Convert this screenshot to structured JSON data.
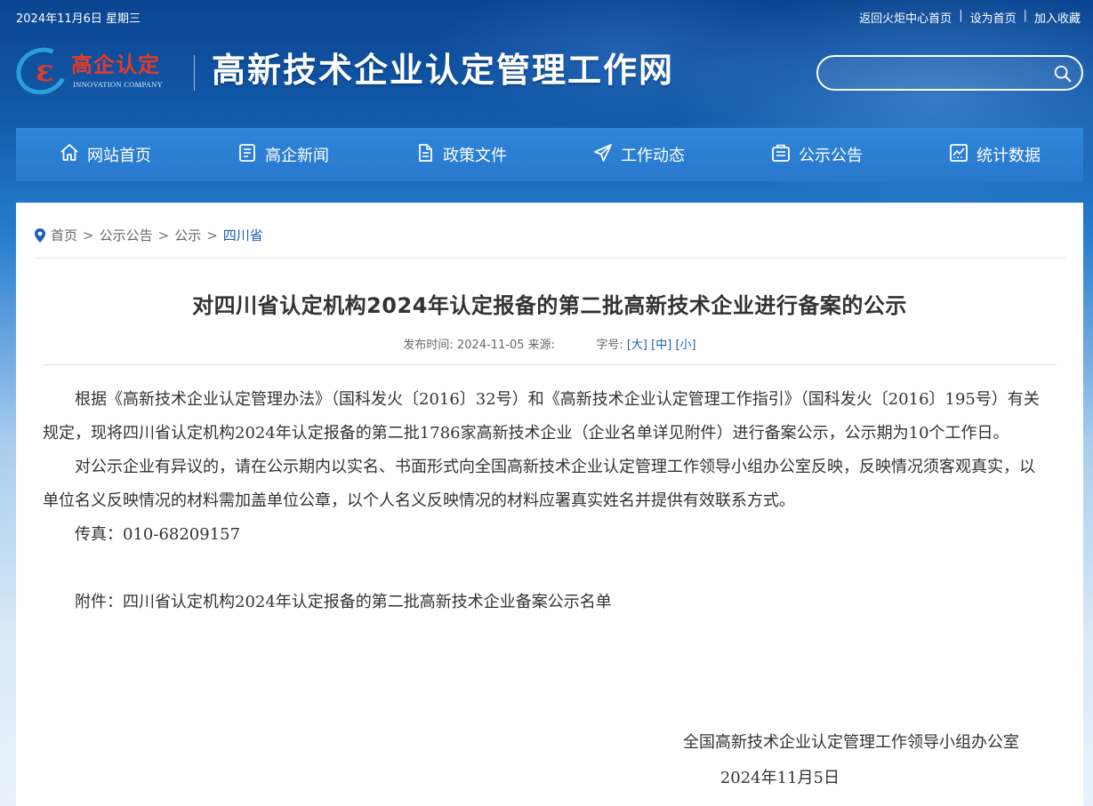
{
  "topbar": {
    "date": "2024年11月6日 星期三",
    "links": [
      "返回火炬中心首页",
      "设为首页",
      "加入收藏"
    ],
    "separator": "|"
  },
  "logo": {
    "mark": "ε",
    "text": "高企认定",
    "subtitle": "INNOVATION COMPANY"
  },
  "site_title": "高新技术企业认定管理工作网",
  "search": {
    "value": "",
    "placeholder": ""
  },
  "nav": [
    {
      "label": "网站首页",
      "icon": "home-icon"
    },
    {
      "label": "高企新闻",
      "icon": "news-icon"
    },
    {
      "label": "政策文件",
      "icon": "document-icon"
    },
    {
      "label": "工作动态",
      "icon": "paper-plane-icon"
    },
    {
      "label": "公示公告",
      "icon": "notice-icon"
    },
    {
      "label": "统计数据",
      "icon": "chart-icon"
    }
  ],
  "breadcrumb": {
    "items": [
      "首页",
      "公示公告",
      "公示",
      "四川省"
    ],
    "separator": ">"
  },
  "article": {
    "title": "对四川省认定机构2024年认定报备的第二批高新技术企业进行备案的公示",
    "meta": {
      "publish_label": "发布时间:",
      "publish_date": "2024-11-05",
      "source_label": "来源:",
      "font_label": "字号:",
      "font_large": "[大]",
      "font_medium": "[中]",
      "font_small": "[小]"
    },
    "paragraphs": [
      "根据《高新技术企业认定管理办法》（国科发火〔2016〕32号）和《高新技术企业认定管理工作指引》（国科发火〔2016〕195号）有关规定，现将四川省认定机构2024年认定报备的第二批1786家高新技术企业（企业名单详见附件）进行备案公示，公示期为10个工作日。",
      "对公示企业有异议的，请在公示期内以实名、书面形式向全国高新技术企业认定管理工作领导小组办公室反映，反映情况须客观真实，以单位名义反映情况的材料需加盖单位公章，以个人名义反映情况的材料应署真实姓名并提供有效联系方式。",
      "传真：010-68209157"
    ],
    "attachment": "附件：四川省认定机构2024年认定报备的第二批高新技术企业备案公示名单",
    "signature": "全国高新技术企业认定管理工作领导小组办公室",
    "sign_date": "2024年11月5日"
  },
  "colors": {
    "header_blue": "#125aaa",
    "nav_blue": "#2f86da",
    "logo_red": "#e23b2b",
    "link_blue": "#1c5fb3"
  }
}
